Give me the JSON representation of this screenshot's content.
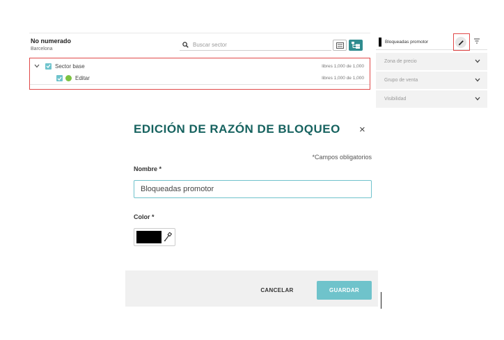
{
  "header": {
    "title": "No numerado",
    "subtitle": "Barcelona"
  },
  "search": {
    "placeholder": "Buscar sector"
  },
  "tree": {
    "rows": [
      {
        "label": "Sector base",
        "count": "libres 1,000 de 1,000"
      },
      {
        "label": "Editar",
        "count": "libres 1,000 de 1,000"
      }
    ]
  },
  "right_panel": {
    "selected_label": "Bloqueadas promotor",
    "accordions": [
      {
        "label": "Zona de precio"
      },
      {
        "label": "Grupo de venta"
      },
      {
        "label": "Visibilidad"
      }
    ]
  },
  "modal": {
    "title": "EDICIÓN DE RAZÓN DE BLOQUEO",
    "close_symbol": "×",
    "required_note": "*Campos obligatorios",
    "name_label": "Nombre *",
    "name_value": "Bloqueadas promotor",
    "color_label": "Color *",
    "color_value": "#000000",
    "cancel_label": "CANCELAR",
    "save_label": "GUARDAR"
  },
  "colors": {
    "accent": "#2f8c8f",
    "title": "#16625f",
    "save_button": "#6fc3cb",
    "highlight_border": "#e04848",
    "checkbox": "#6ec3cc",
    "status_green": "#7cc242"
  },
  "icons": {
    "search": "search-icon",
    "list_view": "list-view-icon",
    "tree_view": "tree-view-icon",
    "edit": "pencil-icon",
    "filter": "filter-icon",
    "chevron": "chevron-down-icon",
    "eyedropper": "eyedropper-icon",
    "check": "checkmark-icon"
  }
}
